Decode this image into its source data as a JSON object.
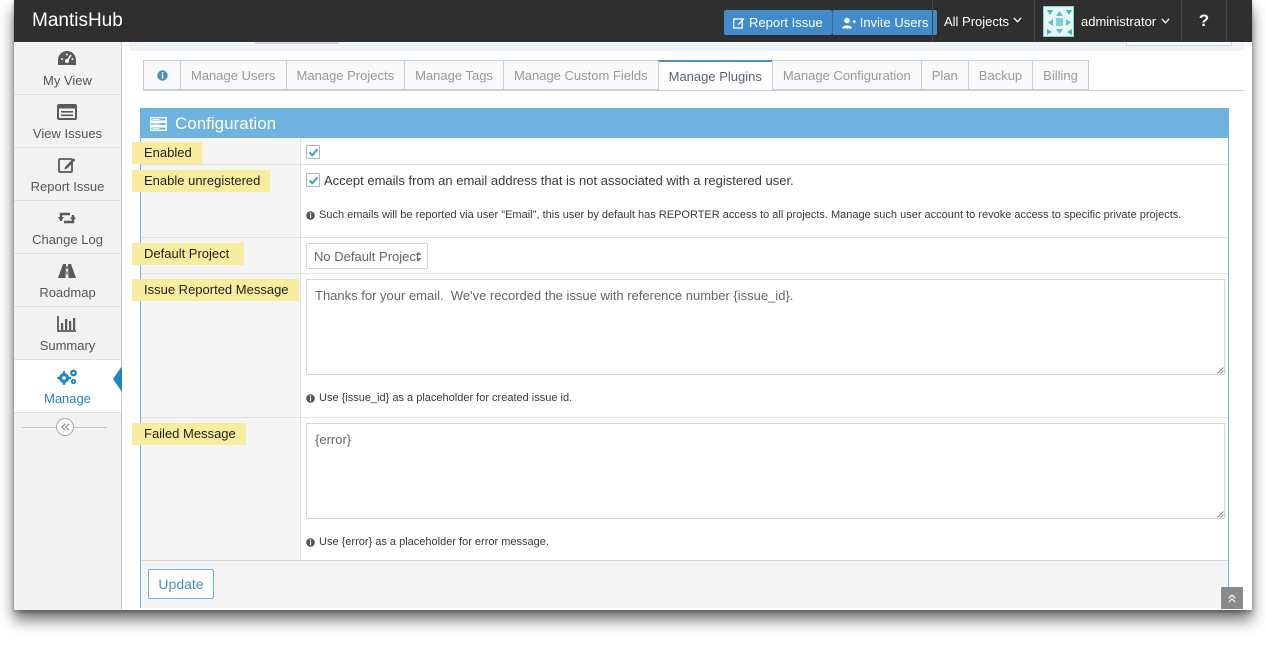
{
  "app": {
    "brand": "MantisHub"
  },
  "navbar": {
    "report_issue": "Report Issue",
    "invite_users": "Invite Users",
    "project_selector": "All Projects",
    "user_name": "administrator",
    "help": "?"
  },
  "sidebar": {
    "items": [
      {
        "label": "My View",
        "icon": "dashboard-icon"
      },
      {
        "label": "View Issues",
        "icon": "list-icon"
      },
      {
        "label": "Report Issue",
        "icon": "edit-icon"
      },
      {
        "label": "Change Log",
        "icon": "retweet-icon"
      },
      {
        "label": "Roadmap",
        "icon": "road-icon"
      },
      {
        "label": "Summary",
        "icon": "bar-chart-icon"
      },
      {
        "label": "Manage",
        "icon": "gears-icon",
        "active": true
      }
    ]
  },
  "tabs": [
    {
      "label": "",
      "icon": "info-icon"
    },
    {
      "label": "Manage Users"
    },
    {
      "label": "Manage Projects"
    },
    {
      "label": "Manage Tags"
    },
    {
      "label": "Manage Custom Fields"
    },
    {
      "label": "Manage Plugins",
      "active": true
    },
    {
      "label": "Manage Configuration"
    },
    {
      "label": "Plan"
    },
    {
      "label": "Backup"
    },
    {
      "label": "Billing"
    }
  ],
  "config": {
    "title": "Configuration",
    "enabled": {
      "label": "Enabled",
      "checked": true
    },
    "enable_unregistered": {
      "label": "Enable unregistered",
      "checked": true,
      "text": "Accept emails from an email address that is not associated with a registered user.",
      "help": "Such emails will be reported via user \"Email\", this user by default has REPORTER access to all projects. Manage such user account to revoke access to specific private projects."
    },
    "default_project": {
      "label": "Default Project",
      "selected": "No Default Project"
    },
    "issue_reported_message": {
      "label": "Issue Reported Message",
      "value": "Thanks for your email.  We've recorded the issue with reference number {issue_id}.",
      "help": "Use {issue_id} as a placeholder for created issue id."
    },
    "failed_message": {
      "label": "Failed Message",
      "value": "{error}",
      "help": "Use {error} as a placeholder for error message."
    },
    "update_label": "Update"
  },
  "colors": {
    "navbar": "#2f2f2f",
    "accent": "#428bca",
    "widget_header": "#6fb3e0",
    "highlight": "#f8ec9e",
    "active_sidebar": "#2283c5"
  }
}
